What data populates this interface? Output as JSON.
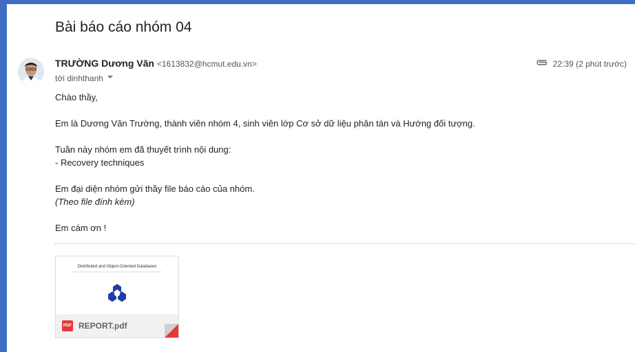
{
  "email": {
    "subject": "Bài báo cáo nhóm 04",
    "sender": {
      "name": "TRƯỜNG Dương Văn",
      "email": "<1613832@hcmut.edu.vn>"
    },
    "to": "tới dinhthanh",
    "time": "22:39 (2 phút trước)",
    "body": {
      "greeting": "Chào thầy,",
      "intro": "Em là Dương Văn Trường, thành viên nhóm 4, sinh viên lớp Cơ sở dữ liệu phân tán và Hướng đối tượng.",
      "presented": "Tuần này nhóm em đã thuyết trình nội dung:",
      "topic": "- Recovery techniques",
      "send": "Em đại diện nhóm gửi thầy file báo cáo của nhóm.",
      "attached_note": "(Theo file đính kèm)",
      "thanks": "Em cám ơn !"
    },
    "attachment": {
      "preview_title": "Distributed and Object-Oriented Databases",
      "file_name": "REPORT.pdf",
      "type_badge": "PDF"
    }
  },
  "icons": {
    "attachment": "paperclip-icon",
    "dropdown": "chevron-down-icon",
    "file_type": "pdf-icon"
  },
  "colors": {
    "frame_background": "#3f6ec4",
    "pdf_red": "#e53935",
    "logo_blue": "#1e3fa8"
  }
}
